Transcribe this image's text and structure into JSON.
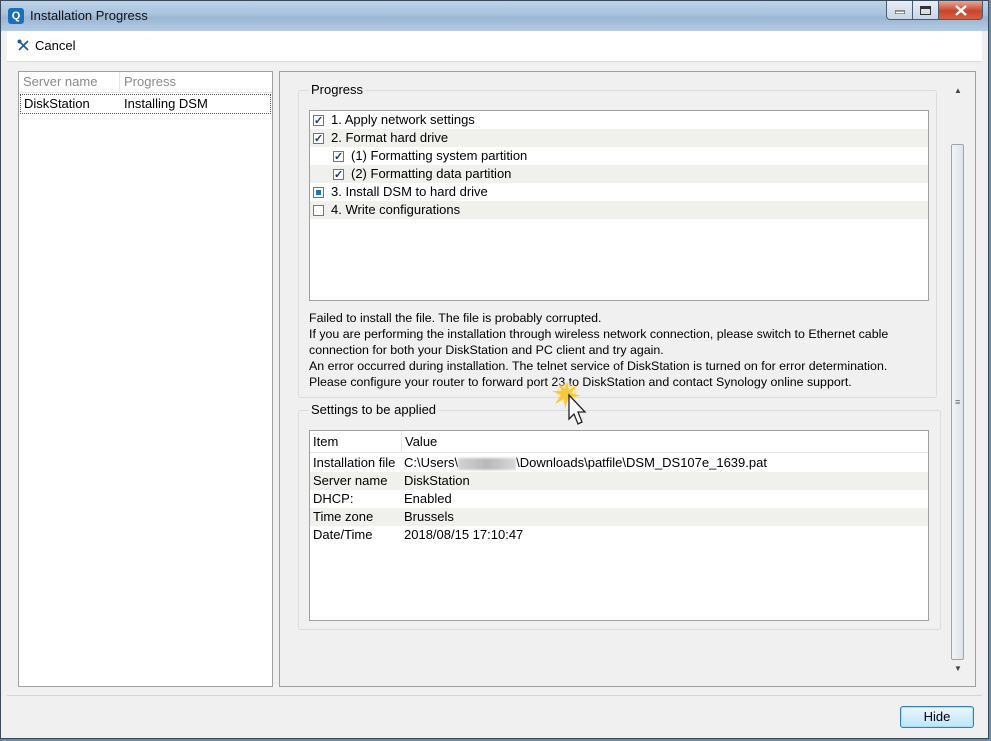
{
  "window": {
    "title": "Installation Progress",
    "app_icon_letter": "Q"
  },
  "toolbar": {
    "cancel_label": "Cancel"
  },
  "servers": {
    "columns": [
      "Server name",
      "Progress"
    ],
    "rows": [
      {
        "name": "DiskStation",
        "progress": "Installing DSM"
      }
    ]
  },
  "progress": {
    "title": "Progress",
    "steps": [
      {
        "label": "1. Apply network settings",
        "state": "checked"
      },
      {
        "label": "2. Format hard drive",
        "state": "checked"
      },
      {
        "label": "(1) Formatting system partition",
        "state": "checked"
      },
      {
        "label": "(2) Formatting data partition",
        "state": "checked"
      },
      {
        "label": "3. Install DSM to hard drive",
        "state": "partial"
      },
      {
        "label": "4. Write configurations",
        "state": "unchecked"
      }
    ],
    "message_lines": [
      "Failed to install the file. The file is probably corrupted.",
      "If you are performing the installation through wireless network connection, please switch to Ethernet cable",
      "connection for both your DiskStation and PC client and try again.",
      "An error occurred during installation. The telnet service of DiskStation is turned on for error determination.",
      "Please configure your router to forward port 23 to DiskStation and contact Synology online support."
    ]
  },
  "settings": {
    "title": "Settings to be applied",
    "columns": [
      "Item",
      "Value"
    ],
    "rows": [
      {
        "item": "Installation file",
        "value_prefix": "C:\\Users\\",
        "value_suffix": "\\Downloads\\patfile\\DSM_DS107e_1639.pat"
      },
      {
        "item": "Server name",
        "value": "DiskStation"
      },
      {
        "item": "DHCP:",
        "value": "Enabled"
      },
      {
        "item": "Time zone",
        "value": "Brussels"
      },
      {
        "item": "Date/Time",
        "value": "2018/08/15 17:10:47"
      }
    ]
  },
  "footer": {
    "hide_label": "Hide"
  },
  "colors": {
    "accent": "#1e73b9",
    "titlebar": "#a8c2dd",
    "close_button": "#c9452e"
  }
}
